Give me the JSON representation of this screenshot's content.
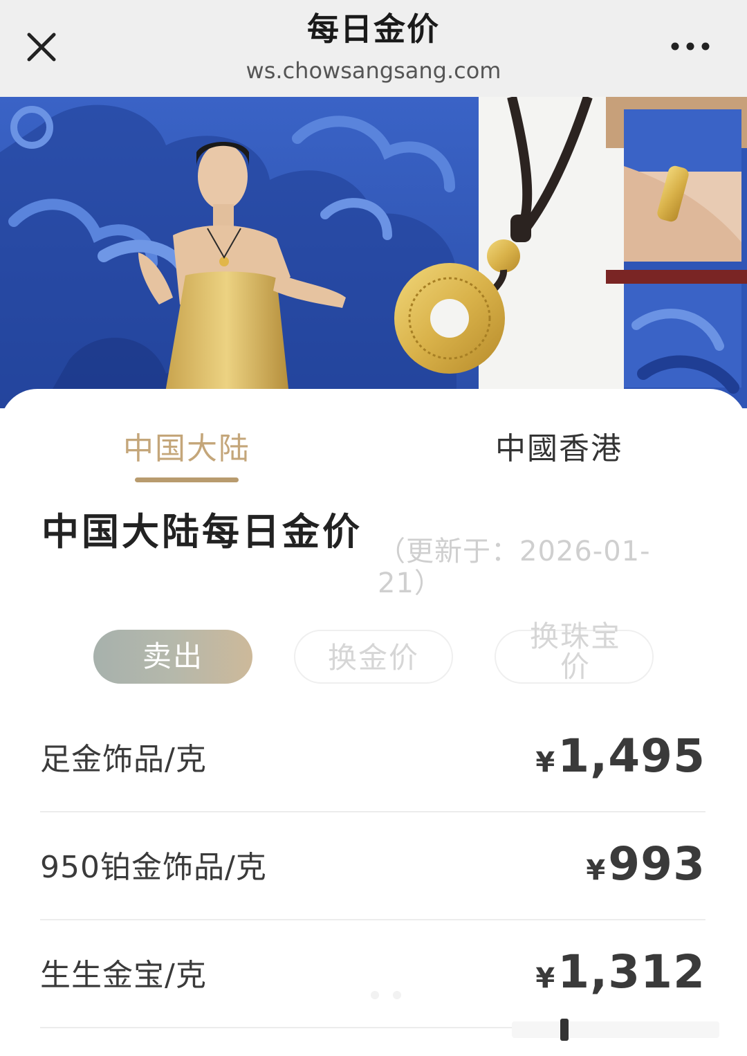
{
  "header": {
    "title": "每日金价",
    "url": "ws.chowsangsang.com",
    "close_icon": "close-icon",
    "more_icon": "more-horizontal-icon"
  },
  "region_tabs": [
    {
      "label": "中国大陆",
      "active": true
    },
    {
      "label": "中國香港",
      "active": false
    }
  ],
  "section": {
    "title": "中国大陆每日金价",
    "update_time": "（更新于：2026-01-21）"
  },
  "price_type_tabs": [
    {
      "label": "卖出",
      "active": true
    },
    {
      "label": "换金价",
      "active": false
    },
    {
      "label": "换珠宝价",
      "active": false
    }
  ],
  "prices": [
    {
      "label": "足金饰品/克",
      "currency": "¥",
      "value": "1,495"
    },
    {
      "label": "950铂金饰品/克",
      "currency": "¥",
      "value": "993"
    },
    {
      "label": "生生金宝/克",
      "currency": "¥",
      "value": "1,312"
    }
  ],
  "colors": {
    "accent_gold": "#c4a67a",
    "banner_blue": "#2f55b6",
    "topbar_bg": "#efefef",
    "text_dark": "#3a3a3a"
  }
}
